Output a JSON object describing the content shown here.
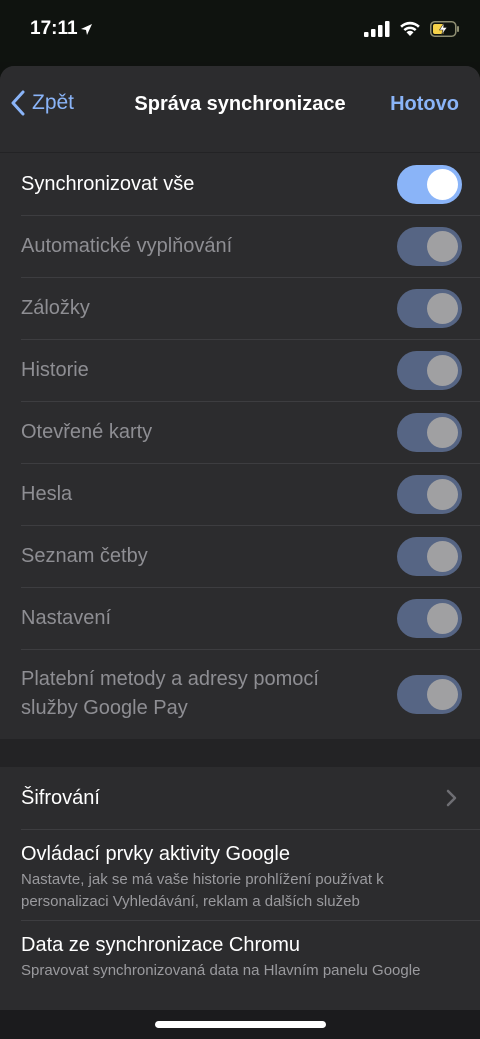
{
  "status_bar": {
    "time": "17:11"
  },
  "nav": {
    "back_label": "Zpět",
    "title": "Správa synchronizace",
    "done_label": "Hotovo"
  },
  "sync_items": [
    {
      "label": "Synchronizovat vše",
      "state": "on"
    },
    {
      "label": "Automatické vyplňování",
      "state": "locked"
    },
    {
      "label": "Záložky",
      "state": "locked"
    },
    {
      "label": "Historie",
      "state": "locked"
    },
    {
      "label": "Otevřené karty",
      "state": "locked"
    },
    {
      "label": "Hesla",
      "state": "locked"
    },
    {
      "label": "Seznam četby",
      "state": "locked"
    },
    {
      "label": "Nastavení",
      "state": "locked"
    },
    {
      "label": "Platební metody a adresy pomocí služby Google Pay",
      "state": "locked"
    }
  ],
  "links": [
    {
      "title": "Šifrování"
    },
    {
      "title": "Ovládací prvky aktivity Google",
      "subtitle": "Nastavte, jak se má vaše historie prohlížení používat k personalizaci Vyhledávání, reklam a dalších služeb"
    },
    {
      "title": "Data ze synchronizace Chromu",
      "subtitle": "Spravovat synchronizovaná data na Hlavním panelu Google"
    }
  ],
  "colors": {
    "accent": "#8ab4f8",
    "toggle_locked": "#566584",
    "background": "#232325",
    "cell": "#2c2c2e"
  }
}
